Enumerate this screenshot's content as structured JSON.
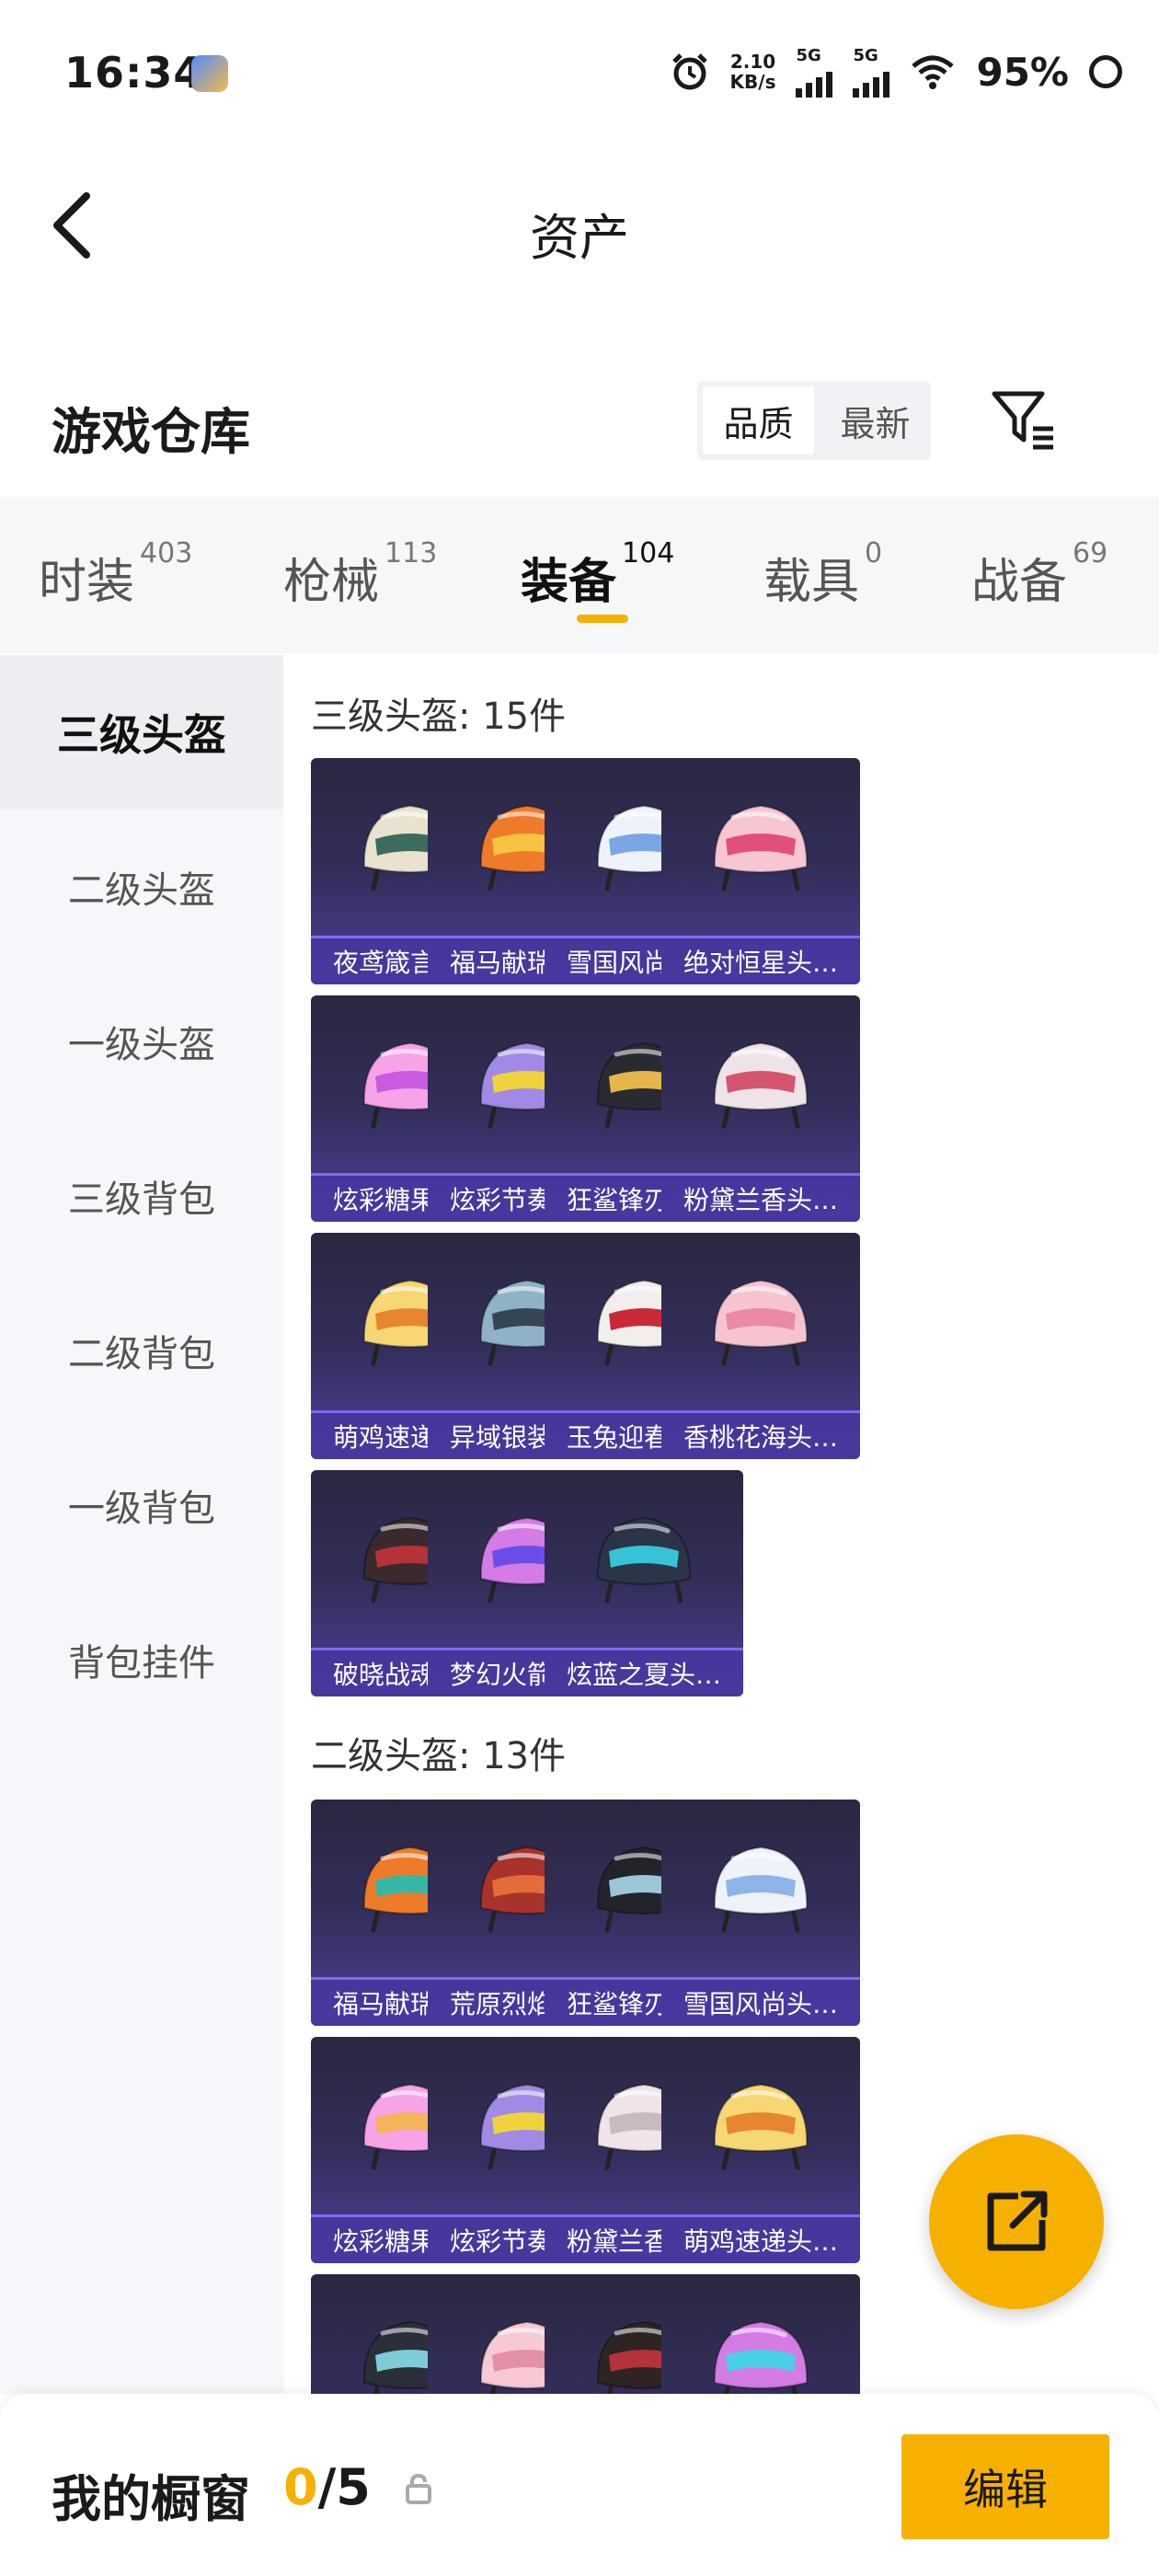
{
  "status_bar": {
    "time": "16:34",
    "net_speed": "2.10",
    "net_unit": "KB/s",
    "signal1": "5G",
    "signal2": "5G",
    "battery": "95%"
  },
  "nav": {
    "title": "资产"
  },
  "warehouse": {
    "title": "游戏仓库",
    "sort_options": [
      "品质",
      "最新"
    ],
    "selected_sort": "品质"
  },
  "tabs": [
    {
      "label": "时装",
      "count": "403"
    },
    {
      "label": "枪械",
      "count": "113"
    },
    {
      "label": "装备",
      "count": "104"
    },
    {
      "label": "载具",
      "count": "0"
    },
    {
      "label": "战备",
      "count": "69"
    }
  ],
  "active_tab": "装备",
  "sidebar": {
    "items": [
      "三级头盔",
      "二级头盔",
      "一级头盔",
      "三级背包",
      "二级背包",
      "一级背包",
      "背包挂件"
    ]
  },
  "groups": [
    {
      "title": "三级头盔: 15件",
      "items": [
        {
          "name": "夜鸢箴言头…",
          "c1": "#e9e2cf",
          "c2": "#3d6b5e"
        },
        {
          "name": "福马献瑞头…",
          "c1": "#ee7b2a",
          "c2": "#f6c342"
        },
        {
          "name": "雪国风尚头…",
          "c1": "#eef3fb",
          "c2": "#7aa6e6"
        },
        {
          "name": "绝对恒星头…",
          "c1": "#f7c6d3",
          "c2": "#e0507a"
        },
        {
          "name": "炫彩糖果头…",
          "c1": "#f7a3e8",
          "c2": "#c85be0"
        },
        {
          "name": "炫彩节奏头…",
          "c1": "#a08ae6",
          "c2": "#f0d23c"
        },
        {
          "name": "狂鲨锋刃头…",
          "c1": "#2a2a33",
          "c2": "#e5b64a"
        },
        {
          "name": "粉黛兰香头…",
          "c1": "#efe3ea",
          "c2": "#d4556f"
        },
        {
          "name": "萌鸡速递头…",
          "c1": "#f7d774",
          "c2": "#e8862f"
        },
        {
          "name": "异域银装头…",
          "c1": "#8fb3c6",
          "c2": "#354552"
        },
        {
          "name": "玉兔迎春头…",
          "c1": "#f2eeee",
          "c2": "#c92a36"
        },
        {
          "name": "香桃花海头…",
          "c1": "#f6c4d1",
          "c2": "#ec8aa6"
        },
        {
          "name": "破晓战魂头…",
          "c1": "#3a2a2e",
          "c2": "#b53238"
        },
        {
          "name": "梦幻火箭头…",
          "c1": "#d57be6",
          "c2": "#6a4ee8"
        },
        {
          "name": "炫蓝之夏头…",
          "c1": "#2b3448",
          "c2": "#37c3d6"
        }
      ]
    },
    {
      "title": "二级头盔: 13件",
      "items": [
        {
          "name": "福马献瑞头…",
          "c1": "#ee7b2a",
          "c2": "#36b7a6"
        },
        {
          "name": "荒原烈焰头…",
          "c1": "#a8332a",
          "c2": "#e46b3a"
        },
        {
          "name": "狂鲨锋刃头…",
          "c1": "#23232b",
          "c2": "#9bc7d6"
        },
        {
          "name": "雪国风尚头…",
          "c1": "#eef3fb",
          "c2": "#8fb4e8"
        },
        {
          "name": "炫彩糖果头…",
          "c1": "#f7a3e8",
          "c2": "#f5b35a"
        },
        {
          "name": "炫彩节奏头…",
          "c1": "#a08ae6",
          "c2": "#f0d23c"
        },
        {
          "name": "粉黛兰香头…",
          "c1": "#f0e4e8",
          "c2": "#c9b9c0"
        },
        {
          "name": "萌鸡速递头…",
          "c1": "#f7d774",
          "c2": "#e8862f"
        },
        {
          "name": "",
          "c1": "#2b2f3a",
          "c2": "#7ecbd9"
        },
        {
          "name": "",
          "c1": "#f6c9d4",
          "c2": "#e58fa8"
        },
        {
          "name": "",
          "c1": "#2e2424",
          "c2": "#b53238"
        },
        {
          "name": "",
          "c1": "#d57be6",
          "c2": "#4ad0e6"
        }
      ]
    }
  ],
  "showcase": {
    "label": "我的橱窗",
    "current": "0",
    "total": "/5"
  },
  "edit_label": "编辑",
  "colors": {
    "accent": "#f6b100"
  },
  "icons": {
    "back": "chevron-left-icon",
    "filter": "filter-icon",
    "share": "share-external-icon",
    "lock": "lock-icon"
  }
}
